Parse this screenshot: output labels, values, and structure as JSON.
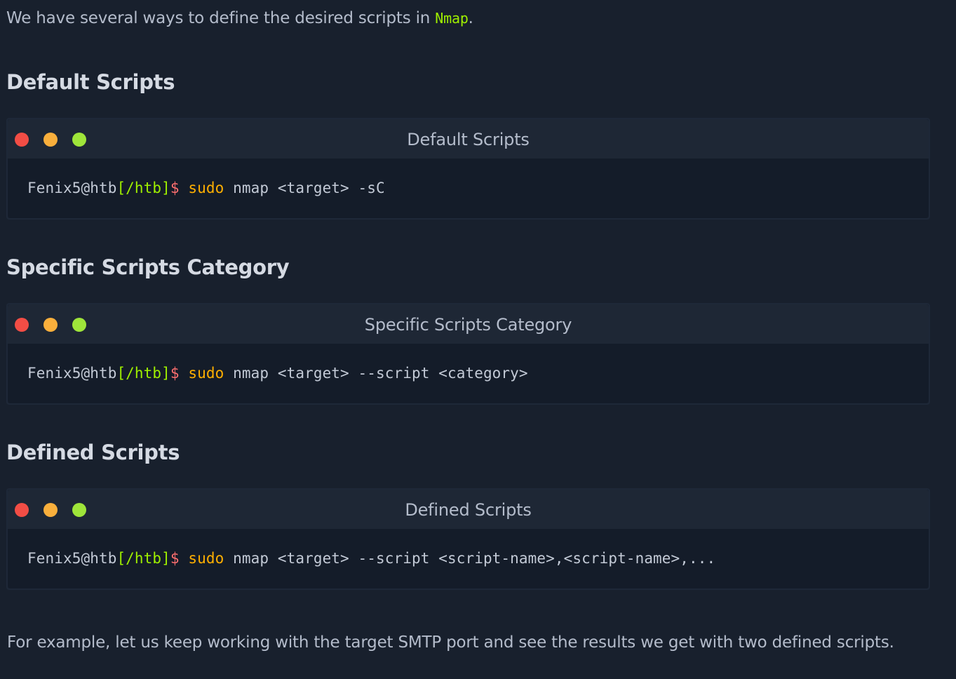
{
  "intro": {
    "text": "We have several ways to define the desired scripts in ",
    "code": "Nmap",
    "end": "."
  },
  "sections": [
    {
      "heading": "Default Scripts",
      "terminal_title": "Default Scripts",
      "prompt_user": "Fenix5@htb",
      "prompt_path": "[/htb]",
      "prompt_symbol": "$",
      "command_keyword": "sudo",
      "command_rest": " nmap <target> -sC"
    },
    {
      "heading": "Specific Scripts Category",
      "terminal_title": "Specific Scripts Category",
      "prompt_user": "Fenix5@htb",
      "prompt_path": "[/htb]",
      "prompt_symbol": "$",
      "command_keyword": "sudo",
      "command_rest": " nmap <target> --script <category>"
    },
    {
      "heading": "Defined Scripts",
      "terminal_title": "Defined Scripts",
      "prompt_user": "Fenix5@htb",
      "prompt_path": "[/htb]",
      "prompt_symbol": "$",
      "command_keyword": "sudo",
      "command_rest": " nmap <target> --script <script-name>,<script-name>,..."
    }
  ],
  "footer": {
    "text": "For example, let us keep working with the target SMTP port and see the results we get with two defined scripts."
  },
  "colors": {
    "background": "#18202d",
    "accent_green": "#9fef00",
    "keyword_orange": "#ffaf00",
    "prompt_red": "#ff6f6f",
    "dot_red": "#f24d45",
    "dot_yellow": "#f9af3c",
    "dot_green": "#9fe53a"
  }
}
